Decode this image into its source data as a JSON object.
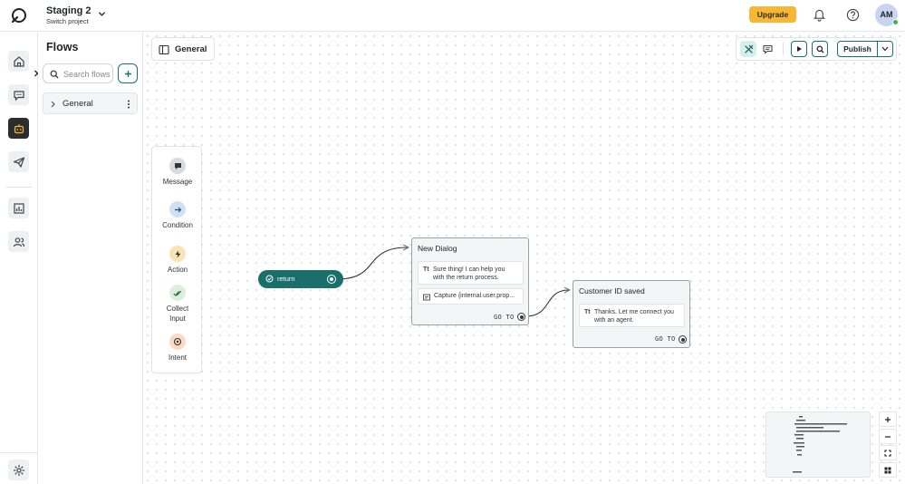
{
  "project": {
    "name": "Staging 2",
    "switch_label": "Switch project"
  },
  "header": {
    "upgrade_label": "Upgrade",
    "avatar_initials": "AM"
  },
  "flows_panel": {
    "title": "Flows",
    "search_placeholder": "Search flows",
    "items": [
      {
        "label": "General"
      }
    ]
  },
  "canvas": {
    "title": "General",
    "publish_label": "Publish"
  },
  "palette": {
    "items": [
      {
        "label": "Message",
        "icon": "message-icon"
      },
      {
        "label": "Condition",
        "icon": "arrow-right-icon"
      },
      {
        "label": "Action",
        "icon": "lightning-icon"
      },
      {
        "label": "Collect Input",
        "icon": "double-check-icon"
      },
      {
        "label": "Intent",
        "icon": "target-icon"
      }
    ]
  },
  "nodes": {
    "start": {
      "label": "return"
    },
    "dialog": {
      "title": "New Dialog",
      "message_line1": "Sure thing! I can help you",
      "message_line2": "with the return process.",
      "capture": "Capture {internal.user.prop...",
      "goto": "GO TO"
    },
    "saved": {
      "title": "Customer ID saved",
      "message_line1": "Thanks. Let me connect you",
      "message_line2": "with an agent.",
      "goto": "GO TO"
    },
    "text_type_glyph": "Tt"
  },
  "colors": {
    "accent": "#1b6f6a",
    "upgrade": "#f7b733",
    "rail_active": "#2b2d31"
  }
}
